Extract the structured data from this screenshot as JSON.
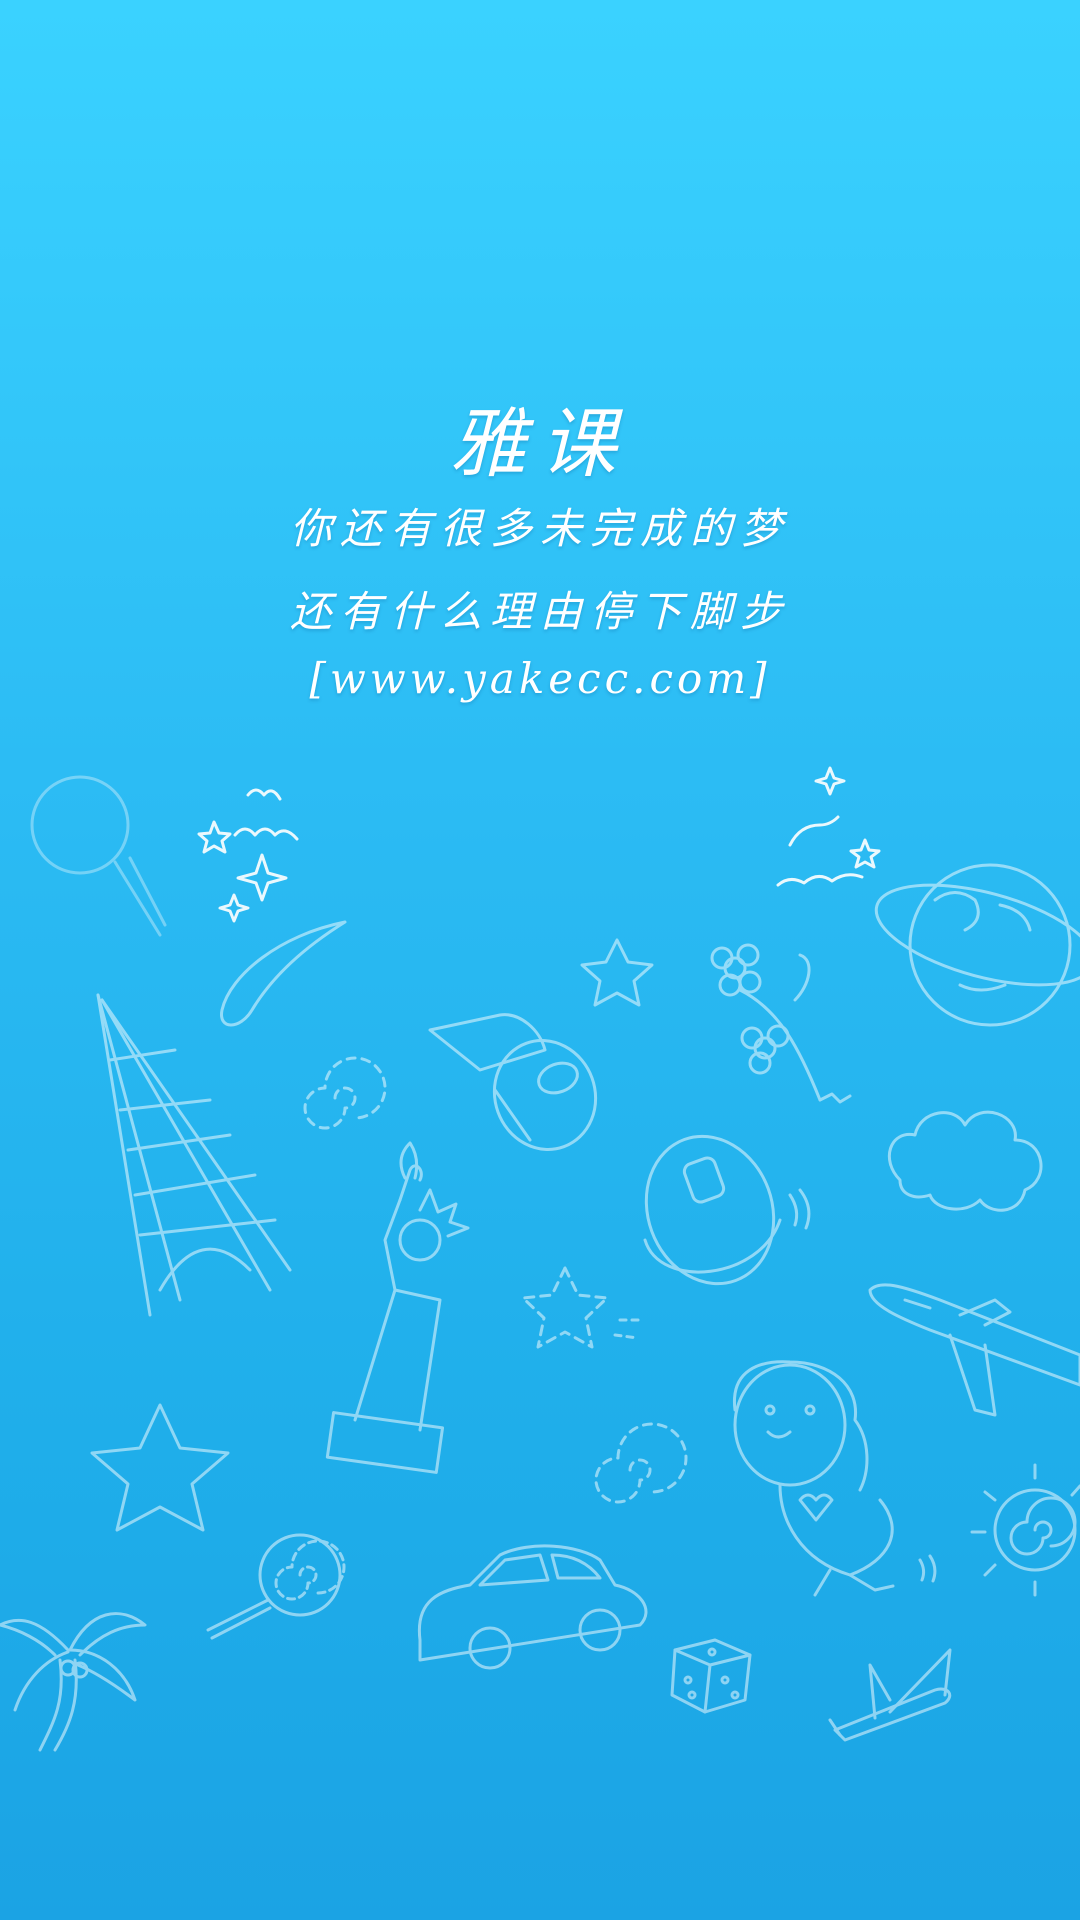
{
  "splash": {
    "app_name": "雅课",
    "slogan_line1": "你还有很多未完成的梦",
    "slogan_line2": "还有什么理由停下脚步",
    "website": "[www.yakecc.com]"
  },
  "theme": {
    "gradient_top": "#3ad2ff",
    "gradient_bottom": "#1ba3e4",
    "text_color": "#ffffff"
  },
  "illustrations": [
    "magnifier-icon",
    "stars-and-birds-icon",
    "moon-icon",
    "star-icon",
    "flower-icon",
    "planet-icon",
    "eiffel-tower-icon",
    "spiral-icon",
    "toilet-paper-icon",
    "ufo-icon",
    "cloud-icon",
    "statue-of-liberty-icon",
    "dashed-star-icon",
    "airplane-icon",
    "girl-icon",
    "sun-icon",
    "lollipop-icon",
    "car-icon",
    "dice-icon",
    "palm-tree-icon",
    "small-plane-icon"
  ]
}
